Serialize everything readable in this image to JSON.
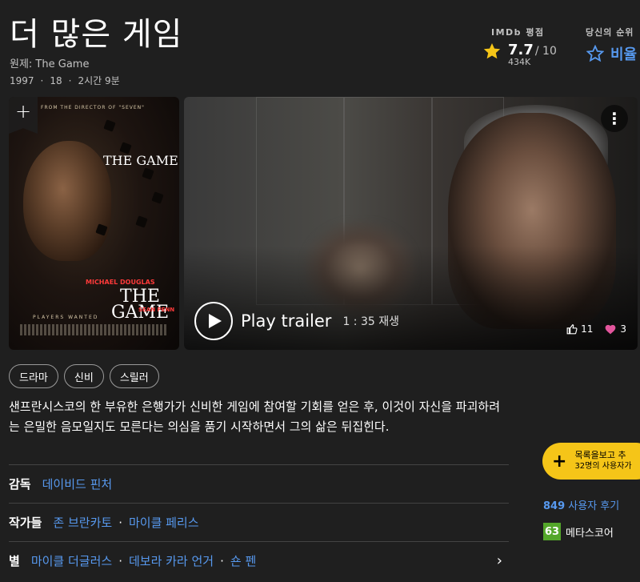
{
  "header": {
    "title": "더 많은 게임",
    "original_title": "원제: The Game",
    "year": "1997",
    "age_rating": "18",
    "runtime": "2시간 9분"
  },
  "rating": {
    "label": "IMDb 평점",
    "value": "7.7",
    "max": "/ 10",
    "count": "434K"
  },
  "your_rating": {
    "label": "당신의 순위",
    "action": "비율"
  },
  "poster": {
    "tagline": "FROM THE DIRECTOR OF \"SEVEN\"",
    "title": "THE GAME",
    "actor1": "MICHAEL DOUGLAS",
    "actor2": "SEAN PENN",
    "footer": "PLAYERS WANTED",
    "add_symbol": "+"
  },
  "trailer": {
    "play_label": "Play trailer",
    "duration": "1 : 35 재생",
    "likes": "11",
    "hearts": "3"
  },
  "genres": [
    "드라마",
    "신비",
    "스릴러"
  ],
  "plot": "샌프란시스코의 한 부유한 은행가가 신비한 게임에 참여할 기회를 얻은 후, 이것이 자신을 파괴하려는 은밀한 음모일지도 모른다는 의심을 품기 시작하면서 그의 삶은 뒤집힌다.",
  "credits": {
    "director_label": "감독",
    "director": "데이비드 핀처",
    "writers_label": "작가들",
    "writer1": "존 브란카토",
    "writer2": "마이클 페리스",
    "stars_label": "별",
    "star1": "마이클 더글러스",
    "star2": "데보라 카라 언거",
    "star3": "숀 펜"
  },
  "side": {
    "watchlist_main": "목록을보고 추",
    "watchlist_sub": "32명의 사용자가",
    "reviews_count": "849",
    "reviews_label": "사용자 후기",
    "metascore": "63",
    "metascore_label": "메타스코어"
  },
  "colors": {
    "background": "#1f1f1f",
    "accent_yellow": "#f5c518",
    "link_blue": "#5799ef",
    "metascore_green": "#54a72a",
    "heart_pink": "#e2559c"
  }
}
